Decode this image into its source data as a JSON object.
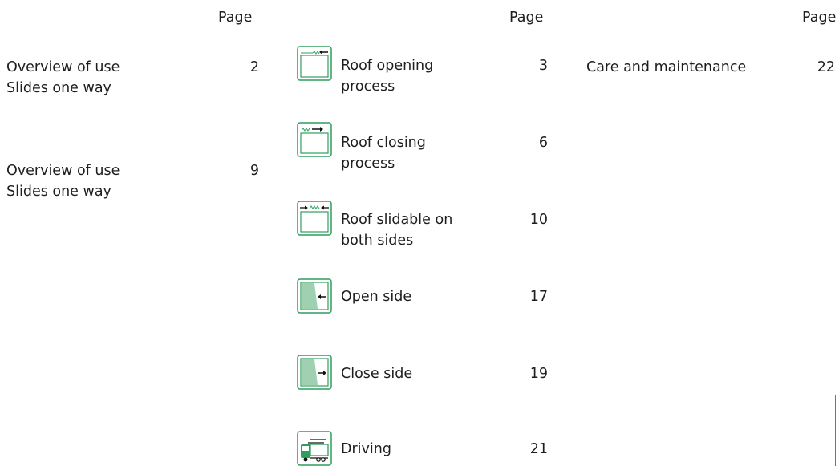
{
  "headers": {
    "col1": "Page",
    "col2": "Page",
    "col3": "Page"
  },
  "col1": [
    {
      "line1": "Overview of use",
      "line2": "Slides one way",
      "page": "2"
    },
    {
      "line1": "Overview of use",
      "line2": "Slides one way",
      "page": "9"
    }
  ],
  "col2": [
    {
      "icon": "roof-opening-icon",
      "line1": "Roof opening",
      "line2": "process",
      "page": "3"
    },
    {
      "icon": "roof-closing-icon",
      "line1": "Roof closing",
      "line2": "process",
      "page": "6"
    },
    {
      "icon": "roof-both-sides-icon",
      "line1": "Roof slidable on",
      "line2": "both sides",
      "page": "10"
    },
    {
      "icon": "open-side-icon",
      "line1": "Open side",
      "line2": "",
      "page": "17"
    },
    {
      "icon": "close-side-icon",
      "line1": "Close side",
      "line2": "",
      "page": "19"
    },
    {
      "icon": "truck-driving-icon",
      "line1": "Driving",
      "line2": "",
      "page": "21"
    }
  ],
  "col3": [
    {
      "line1": "Care and maintenance",
      "page": "22"
    }
  ],
  "colors": {
    "accent": "#2e9e5f",
    "fill": "#9fd1b0",
    "text": "#1e1e1e"
  }
}
